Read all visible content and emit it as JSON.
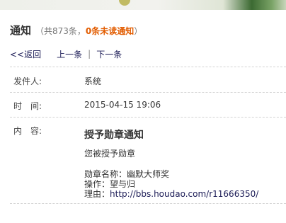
{
  "header": {
    "title": "通知",
    "summary_prefix": "（共873条，",
    "summary_unread": "0条未读通知",
    "summary_suffix": "）"
  },
  "nav": {
    "back": "<<返回",
    "prev": "上一条",
    "separator": "|",
    "next": "下一条"
  },
  "fields": {
    "sender_label": "发件人:",
    "sender_value": "系统",
    "time_label": "时　间:",
    "time_value": "2015-04-15 19:06",
    "content_label": "内　容:"
  },
  "message": {
    "title": "授予勋章通知",
    "body": "您被授予勋章",
    "medal_name": "勋章名称：幽默大师奖",
    "operator": "操作：望与归",
    "reason_prefix": "理由：",
    "reason_link": "http://bbs.houdao.com/r11666350/"
  },
  "colors": {
    "unread": "#e25c00",
    "link": "#1a1a55"
  }
}
